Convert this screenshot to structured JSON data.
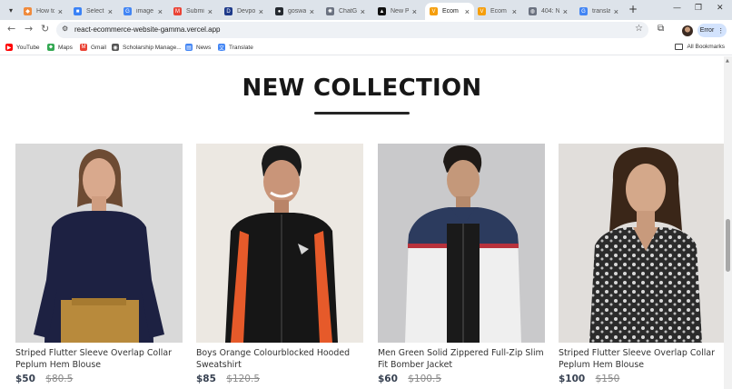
{
  "browser": {
    "tabs": [
      {
        "title": "How to",
        "color": "#f08a3c",
        "glyph": "◆",
        "active": false
      },
      {
        "title": "Select",
        "color": "#3b82f6",
        "glyph": "■",
        "active": false
      },
      {
        "title": "image",
        "color": "#4285f4",
        "glyph": "G",
        "active": false
      },
      {
        "title": "Submi",
        "color": "#ea4335",
        "glyph": "M",
        "active": false
      },
      {
        "title": "Devpo",
        "color": "#1e3a8a",
        "glyph": "D",
        "active": false
      },
      {
        "title": "goswa",
        "color": "#24292f",
        "glyph": "●",
        "active": false
      },
      {
        "title": "ChatG",
        "color": "#6b7280",
        "glyph": "✺",
        "active": false
      },
      {
        "title": "New P",
        "color": "#111111",
        "glyph": "▲",
        "active": false
      },
      {
        "title": "Ecom",
        "color": "#f59e0b",
        "glyph": "V",
        "active": true
      },
      {
        "title": "Ecom",
        "color": "#f59e0b",
        "glyph": "V",
        "active": false
      },
      {
        "title": "404: N",
        "color": "#6b7280",
        "glyph": "◍",
        "active": false
      },
      {
        "title": "transla",
        "color": "#4285f4",
        "glyph": "G",
        "active": false
      }
    ],
    "url": "react-ecommerce-website-gamma.vercel.app",
    "error_label": "Error",
    "bookmarks": [
      {
        "label": "YouTube",
        "color": "#ff0000",
        "glyph": "▶"
      },
      {
        "label": "Maps",
        "color": "#34a853",
        "glyph": "⬥"
      },
      {
        "label": "Gmail",
        "color": "#ea4335",
        "glyph": "M"
      },
      {
        "label": "Scholarship Manage...",
        "color": "#555555",
        "glyph": "◉"
      },
      {
        "label": "News",
        "color": "#4285f4",
        "glyph": "▤"
      },
      {
        "label": "Translate",
        "color": "#4285f4",
        "glyph": "文"
      }
    ],
    "all_bookmarks_label": "All Bookmarks"
  },
  "page": {
    "heading": "NEW COLLECTION",
    "products": [
      {
        "name": "Striped Flutter Sleeve Overlap Collar Peplum Hem Blouse",
        "new_price": "$50",
        "old_price": "$80.5"
      },
      {
        "name": "Boys Orange Colourblocked Hooded Sweatshirt",
        "new_price": "$85",
        "old_price": "$120.5"
      },
      {
        "name": "Men Green Solid Zippered Full-Zip Slim Fit Bomber Jacket",
        "new_price": "$60",
        "old_price": "$100.5"
      },
      {
        "name": "Striped Flutter Sleeve Overlap Collar Peplum Hem Blouse",
        "new_price": "$100",
        "old_price": "$150"
      }
    ]
  }
}
